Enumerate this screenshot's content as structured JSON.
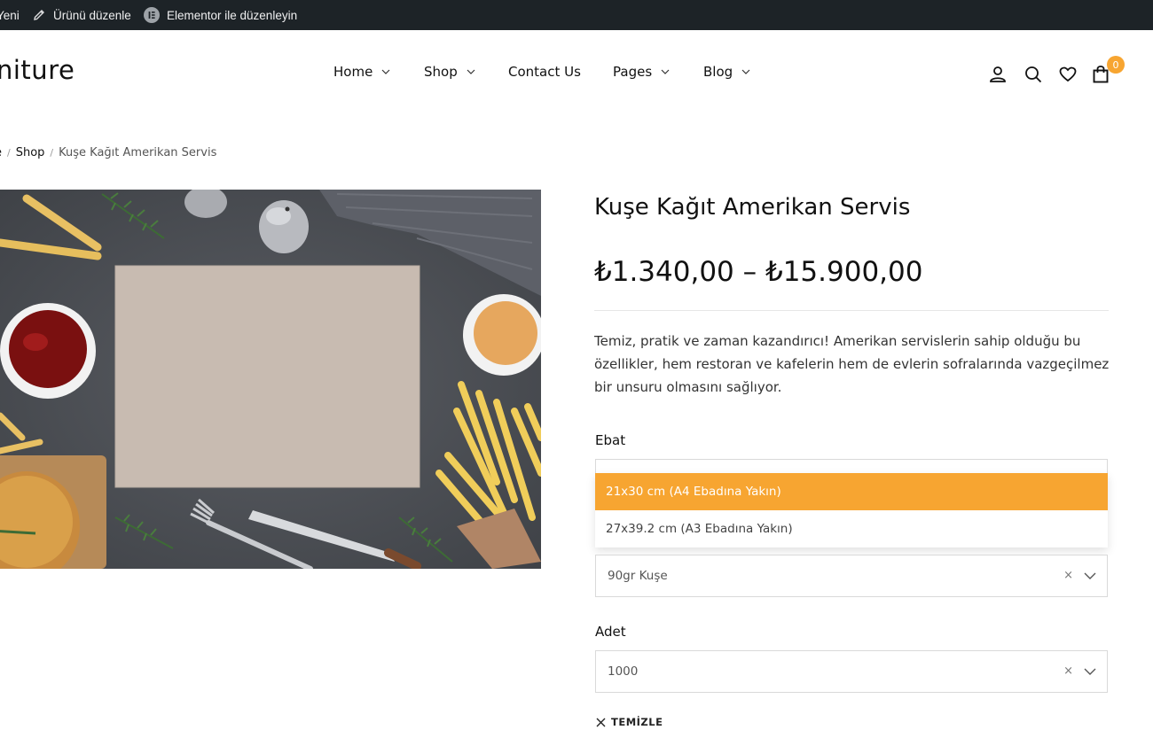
{
  "admin_bar": {
    "new_label": "Yeni",
    "edit_product_label": "Ürünü düzenle",
    "elementor_label": "Elementor ile düzenleyin"
  },
  "header": {
    "logo": "niture",
    "nav": [
      {
        "label": "Home",
        "has_dropdown": true
      },
      {
        "label": "Shop",
        "has_dropdown": true
      },
      {
        "label": "Contact Us",
        "has_dropdown": false
      },
      {
        "label": "Pages",
        "has_dropdown": true
      },
      {
        "label": "Blog",
        "has_dropdown": true
      }
    ],
    "icons": [
      "user-icon",
      "search-icon",
      "heart-icon",
      "bag-icon"
    ],
    "cart_count": "0",
    "accent_color": "#f7a531"
  },
  "breadcrumb": {
    "home": "e",
    "shop": "Shop",
    "current": "Kuşe Kağıt Amerikan Servis"
  },
  "product": {
    "title": "Kuşe Kağıt Amerikan Servis",
    "price": "₺1.340,00 – ₺15.900,00",
    "description": "Temiz, pratik ve zaman kazandırıcı! Amerikan servislerin sahip olduğu bu özellikler, hem restoran ve kafelerin hem de evlerin sofralarında vazgeçilmez bir unsuru olmasını sağlıyor.",
    "ebat": {
      "label": "Ebat",
      "options": [
        "21x30 cm (A4 Ebadına Yakın)",
        "27x39.2 cm (A3 Ebadına Yakın)"
      ],
      "highlighted": "21x30 cm (A4 Ebadına Yakın)"
    },
    "kagit": {
      "value": "90gr Kuşe",
      "clear": "×"
    },
    "adet": {
      "label": "Adet",
      "value": "1000",
      "clear": "×"
    },
    "clear_label": "TEMİZLE"
  }
}
